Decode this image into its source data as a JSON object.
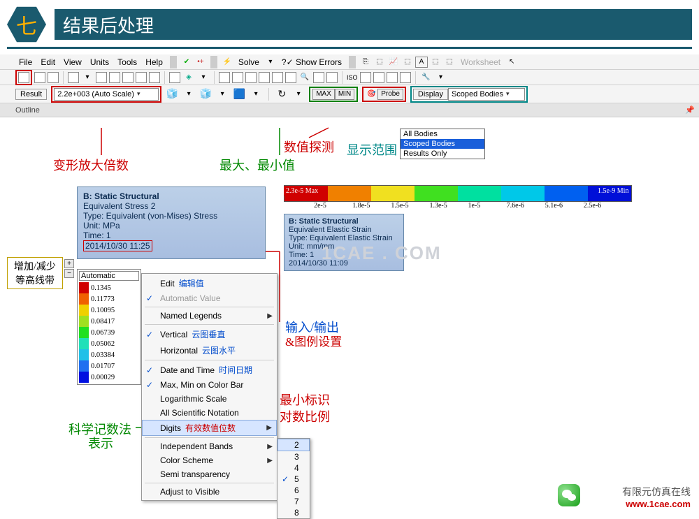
{
  "banner": {
    "num": "七",
    "title": "结果后处理"
  },
  "menu": [
    "File",
    "Edit",
    "View",
    "Units",
    "Tools",
    "Help"
  ],
  "solve": "Solve",
  "show_errors": "?✓ Show Errors",
  "worksheet": "Worksheet",
  "result_label": "Result",
  "result_combo": "2.2e+003 (Auto Scale)",
  "max_btn": "MAX",
  "min_btn": "MIN",
  "probe": "Probe",
  "display_label": "Display",
  "display_combo": "Scoped Bodies",
  "display_opts": [
    "All Bodies",
    "Scoped Bodies",
    "Results Only"
  ],
  "outline": "Outline",
  "ann": {
    "scale": "变形放大倍数",
    "maxmin": "最大、最小值",
    "probe": "数值探测",
    "range": "显示范围",
    "pm": "增加/减少\n等高线带",
    "io": "输入/输出",
    "legend": "&图例设置",
    "minmark": "最小标识",
    "log": "对数比例",
    "sci1": "科学记数法",
    "sci2": "表示",
    "digitszh": "有效数值位数"
  },
  "resbox": {
    "title": "B: Static Structural",
    "l2": "Equivalent Stress 2",
    "l3": "Type: Equivalent (von-Mises) Stress",
    "l4": "Unit: MPa",
    "l5": "Time: 1",
    "ts": "2014/10/30 11:25"
  },
  "leg": {
    "auto": "Automatic",
    "rows": [
      {
        "c": "#d00000",
        "t": "0.1345"
      },
      {
        "c": "#f06000",
        "t": "0.11773"
      },
      {
        "c": "#f0d000",
        "t": "0.10095"
      },
      {
        "c": "#a0e020",
        "t": "0.08417"
      },
      {
        "c": "#20e020",
        "t": "0.06739"
      },
      {
        "c": "#20e0b8",
        "t": "0.05062"
      },
      {
        "c": "#20c0e8",
        "t": "0.03384"
      },
      {
        "c": "#2070f0",
        "t": "0.01707"
      },
      {
        "c": "#0010e0",
        "t": "0.00029"
      }
    ]
  },
  "ctx": {
    "edit": "Edit",
    "edit_zh": "编辑值",
    "auto": "Automatic Value",
    "named": "Named Legends",
    "vert": "Vertical",
    "vert_zh": "云图垂直",
    "horiz": "Horizontal",
    "horiz_zh": "云图水平",
    "dt": "Date and Time",
    "dt_zh": "时间日期",
    "mm": "Max, Min on Color Bar",
    "log": "Logarithmic Scale",
    "sci": "All Scientific Notation",
    "dig": "Digits",
    "ib": "Independent Bands",
    "cs": "Color Scheme",
    "st": "Semi transparency",
    "av": "Adjust to Visible"
  },
  "digits_sub": [
    "2",
    "3",
    "4",
    "5",
    "6",
    "7",
    "8"
  ],
  "digits_checked": "5",
  "digits_hl": "2",
  "hbar": {
    "colors": [
      "#d00000",
      "#f08000",
      "#f0e020",
      "#40e020",
      "#00e0a0",
      "#00c8e8",
      "#0060f0",
      "#0010d8"
    ],
    "ticks": [
      "2.3e-5 Max",
      "2e-5",
      "1.8e-5",
      "1.5e-5",
      "1.3e-5",
      "1e-5",
      "7.6e-6",
      "5.1e-6",
      "2.5e-6",
      "1.5e-9 Min"
    ],
    "meta": {
      "title": "B: Static Structural",
      "l2": "Equivalent Elastic Strain",
      "l3": "Type: Equivalent Elastic Strain",
      "l4": "Unit: mm/mm",
      "l5": "Time: 1",
      "ts": "2014/10/30 11:09"
    }
  },
  "watermark": "1CAE . COM",
  "brand": {
    "l1": "有限元仿真在线",
    "l2": "www.1cae.com"
  }
}
